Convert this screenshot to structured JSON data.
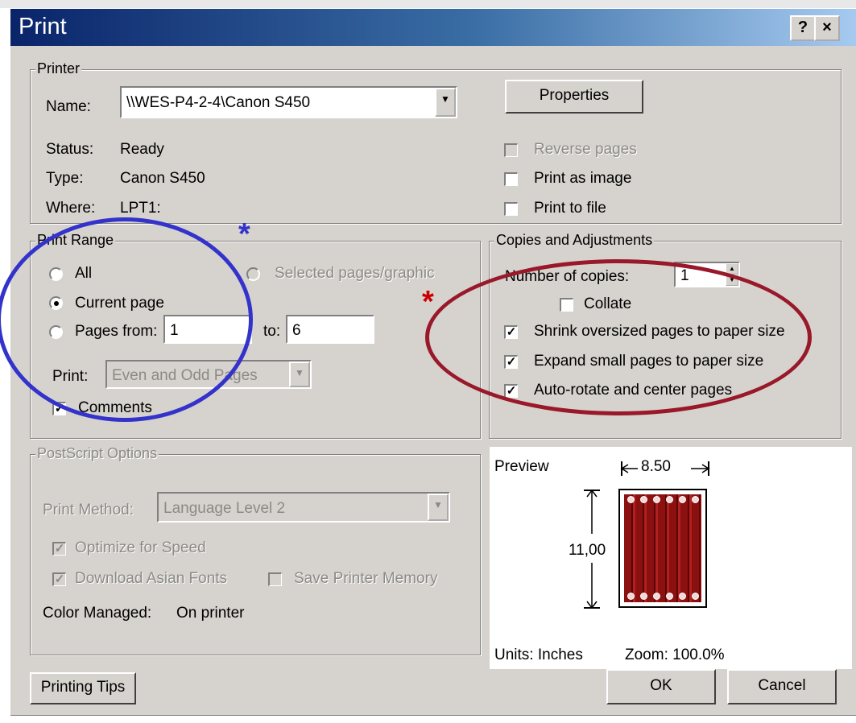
{
  "window": {
    "title": "Print",
    "help": "?",
    "close": "×"
  },
  "printer": {
    "group_label": "Printer",
    "name_label": "Name:",
    "name_value": "\\\\WES-P4-2-4\\Canon S450",
    "properties_button": "Properties",
    "status_label": "Status:",
    "status_value": "Ready",
    "type_label": "Type:",
    "type_value": "Canon S450",
    "where_label": "Where:",
    "where_value": "LPT1:",
    "reverse_pages": {
      "label": "Reverse pages",
      "checked": false,
      "enabled": false
    },
    "print_as_image": {
      "label": "Print as image",
      "checked": false
    },
    "print_to_file": {
      "label": "Print to file",
      "checked": false
    }
  },
  "range": {
    "group_label": "Print Range",
    "all_label": "All",
    "selected_label": "Selected pages/graphic",
    "current_label": "Current page",
    "pages_from_label": "Pages from:",
    "from_value": "1",
    "to_label": "to:",
    "to_value": "6",
    "print_label": "Print:",
    "print_value": "Even and Odd Pages",
    "comments_label": "Comments",
    "selected_option": "Current page"
  },
  "copies": {
    "group_label": "Copies and Adjustments",
    "number_label": "Number of copies:",
    "number_value": "1",
    "collate": {
      "label": "Collate",
      "checked": false
    },
    "shrink": {
      "label": "Shrink oversized pages to paper size",
      "checked": true
    },
    "expand": {
      "label": "Expand small pages to paper size",
      "checked": true
    },
    "autorotate": {
      "label": "Auto-rotate and center pages",
      "checked": true
    }
  },
  "postscript": {
    "group_label": "PostScript Options",
    "method_label": "Print Method:",
    "method_value": "Language Level 2",
    "optimize": {
      "label": "Optimize for Speed",
      "checked": true
    },
    "download_fonts": {
      "label": "Download Asian Fonts",
      "checked": true
    },
    "save_memory": {
      "label": "Save Printer Memory",
      "checked": false
    },
    "color_label": "Color Managed:",
    "color_value": "On printer"
  },
  "preview": {
    "label": "Preview",
    "width": "8.50",
    "height": "11,00",
    "units": "Units: Inches",
    "zoom": "Zoom: 100.0%"
  },
  "buttons": {
    "tips": "Printing Tips",
    "ok": "OK",
    "cancel": "Cancel"
  },
  "annotations": {
    "star": "*",
    "blue": "#3333cc",
    "red": "#cc0000",
    "ellipse_red": "#99182a"
  },
  "icons": [
    "help-icon",
    "close-icon",
    "dropdown-arrow-icon",
    "checkbox-checked-icon",
    "radio-selected-icon",
    "spin-up-icon",
    "spin-down-icon",
    "width-arrow-icon",
    "height-arrow-icon"
  ]
}
